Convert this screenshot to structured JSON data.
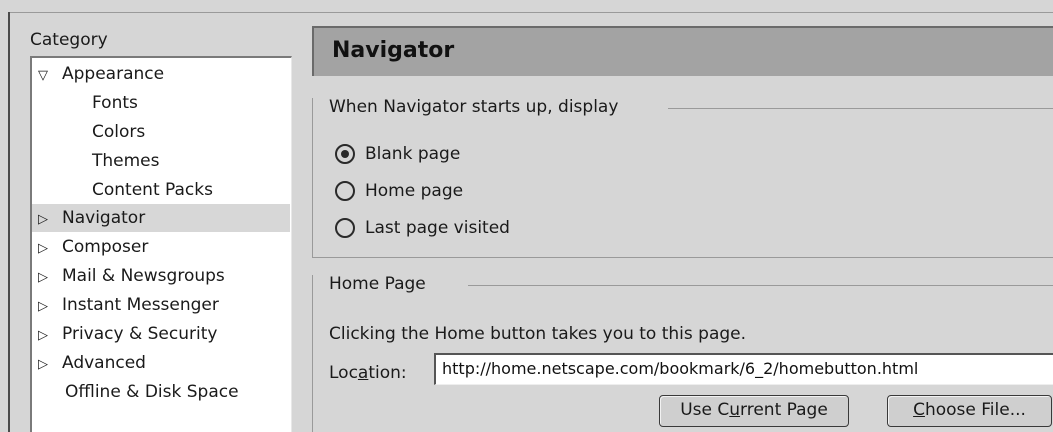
{
  "category": {
    "label": "Category",
    "items": [
      {
        "label": "Appearance",
        "twisty": "open"
      },
      {
        "label": "Fonts"
      },
      {
        "label": "Colors"
      },
      {
        "label": "Themes"
      },
      {
        "label": "Content Packs"
      },
      {
        "label": "Navigator",
        "twisty": "closed",
        "selected": true
      },
      {
        "label": "Composer",
        "twisty": "closed"
      },
      {
        "label": "Mail & Newsgroups",
        "twisty": "closed"
      },
      {
        "label": "Instant Messenger",
        "twisty": "closed"
      },
      {
        "label": "Privacy & Security",
        "twisty": "closed"
      },
      {
        "label": "Advanced",
        "twisty": "closed"
      },
      {
        "label": "Offline & Disk Space"
      }
    ]
  },
  "panel": {
    "title": "Navigator",
    "startup": {
      "legend": "When Navigator starts up, display",
      "options": [
        "Blank page",
        "Home page",
        "Last page visited"
      ],
      "selected": "Blank page"
    },
    "homepage": {
      "legend": "Home Page",
      "description": "Clicking the Home button takes you to this page.",
      "location_label_pre": "Loc",
      "location_label_key": "a",
      "location_label_post": "tion:",
      "location_value": "http://home.netscape.com/bookmark/6_2/homebutton.html",
      "use_current_pre": "Use C",
      "use_current_key": "u",
      "use_current_post": "rrent Page",
      "choose_key": "C",
      "choose_post": "hoose File..."
    }
  },
  "icons": {
    "twisty_open": "triangle-down-icon",
    "twisty_closed": "triangle-right-icon"
  }
}
